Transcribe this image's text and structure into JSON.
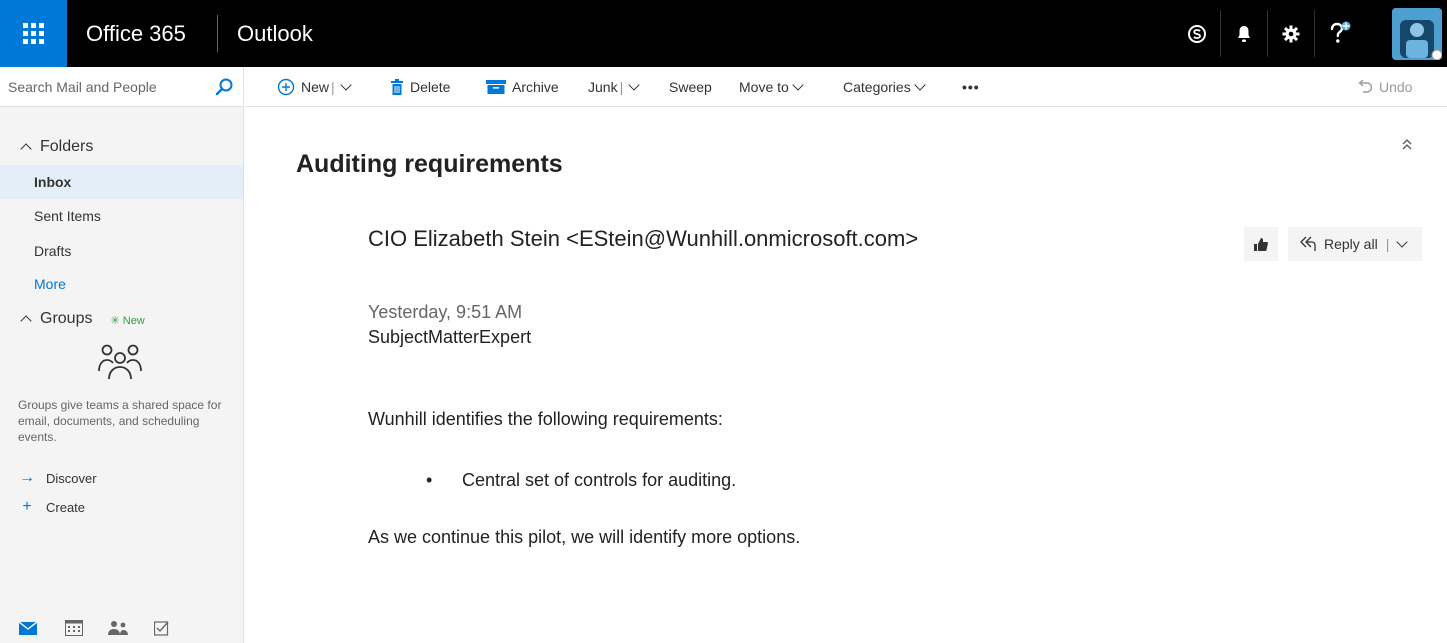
{
  "topbar": {
    "brand": "Office 365",
    "app": "Outlook",
    "icons": [
      "app-launcher-icon",
      "skype-icon",
      "bell-icon",
      "gear-icon",
      "help-icon",
      "avatar"
    ],
    "colors": {
      "bar": "#000000",
      "launcher": "#0078d7"
    }
  },
  "search": {
    "placeholder": "Search Mail and People"
  },
  "commands": {
    "new": "New",
    "delete": "Delete",
    "archive": "Archive",
    "junk": "Junk",
    "sweep": "Sweep",
    "move_to": "Move to",
    "categories": "Categories",
    "more": "•••",
    "undo": "Undo"
  },
  "sidebar": {
    "folders_header": "Folders",
    "items": [
      {
        "label": "Inbox",
        "selected": true
      },
      {
        "label": "Sent Items",
        "selected": false
      },
      {
        "label": "Drafts",
        "selected": false
      }
    ],
    "more": "More",
    "groups_header": "Groups",
    "groups_badge": "New",
    "groups_description": "Groups give teams a shared space for email, documents, and scheduling events.",
    "discover": "Discover",
    "create": "Create",
    "modules": [
      "mail-icon",
      "calendar-icon",
      "people-icon",
      "tasks-icon"
    ]
  },
  "message": {
    "subject": "Auditing requirements",
    "sender": "CIO Elizabeth Stein <EStein@Wunhill.onmicrosoft.com>",
    "reply_all": "Reply all",
    "timestamp": "Yesterday, 9:51 AM",
    "to": "SubjectMatterExpert",
    "body_intro": "Wunhill identifies the following requirements:",
    "bullets": [
      "Central set of controls for auditing."
    ],
    "bullet_glyph": "•",
    "body_outro": "As we continue this pilot, we will identify more options."
  }
}
